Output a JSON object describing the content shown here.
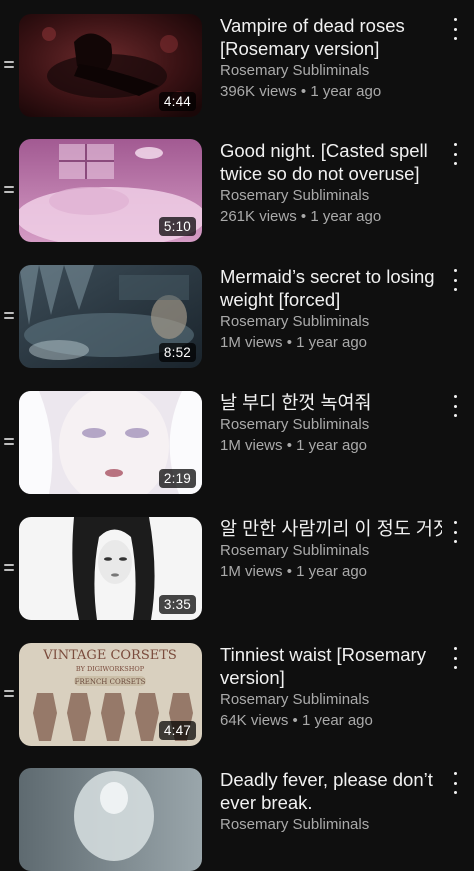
{
  "videos": [
    {
      "title": "Vampire of dead roses [Rosemary version]",
      "channel": "Rosemary Subliminals",
      "views": "396K views",
      "age": "1 year ago",
      "duration": "4:44",
      "thumb_palette": [
        "#2a0d0f",
        "#5e1f22",
        "#c9b2a8"
      ]
    },
    {
      "title": "Good night. [Casted spell twice so do not overuse]",
      "channel": "Rosemary Subliminals",
      "views": "261K views",
      "age": "1 year ago",
      "duration": "5:10",
      "thumb_palette": [
        "#7a3b6a",
        "#c17fb0",
        "#e6b7d9"
      ]
    },
    {
      "title": "Mermaid’s secret to losing weight [forced]",
      "channel": "Rosemary Subliminals",
      "views": "1M views",
      "age": "1 year ago",
      "duration": "8:52",
      "thumb_palette": [
        "#1f2b36",
        "#4f6471",
        "#9fb2bb"
      ]
    },
    {
      "title": "날 부디 한껏 녹여줘",
      "channel": "Rosemary Subliminals",
      "views": "1M views",
      "age": "1 year ago",
      "duration": "2:19",
      "thumb_palette": [
        "#d9d3e0",
        "#f1ecef",
        "#b07c86"
      ]
    },
    {
      "title": "알 만한 사람끼리 이 정도 거짓말엔 속아주는 게 예의 아닌가요",
      "channel": "Rosemary Subliminals",
      "views": "1M views",
      "age": "1 year ago",
      "duration": "3:35",
      "thumb_palette": [
        "#f4f4f4",
        "#2a2a2a",
        "#9a9a9a"
      ]
    },
    {
      "title": "Tinniest waist [Rosemary version]",
      "channel": "Rosemary Subliminals",
      "views": "64K views",
      "age": "1 year ago",
      "duration": "4:47",
      "thumb_palette": [
        "#d8cfbd",
        "#8a6a5a",
        "#4a3a33"
      ],
      "thumb_text": [
        "VINTAGE CORSETS",
        "BY DIGIWORKSHOP",
        "FRENCH CORSETS"
      ]
    },
    {
      "title": "Deadly fever, please don’t ever break.",
      "channel": "Rosemary Subliminals",
      "views": "",
      "age": "",
      "duration": "",
      "thumb_palette": [
        "#6f7b80",
        "#b6c0c3",
        "#e0e6e8"
      ]
    }
  ],
  "separator": "•"
}
